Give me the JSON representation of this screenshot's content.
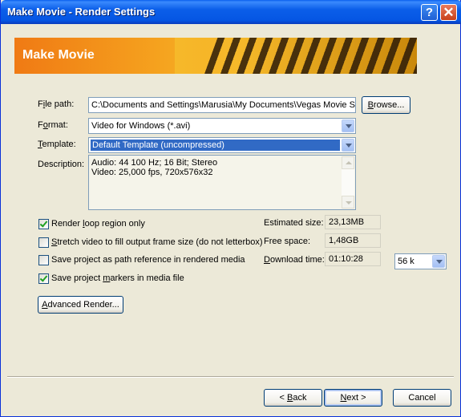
{
  "window": {
    "title": "Make Movie - Render Settings",
    "help_label": "?",
    "close_label": "✕"
  },
  "banner": {
    "title": "Make Movie"
  },
  "file_path": {
    "label_pre": "F",
    "label_ul": "i",
    "label_post": "le path:",
    "value": "C:\\Documents and Settings\\Marusia\\My Documents\\Vegas Movie S",
    "browse_pre": "",
    "browse_ul": "B",
    "browse_post": "rowse..."
  },
  "format": {
    "label_pre": "F",
    "label_ul": "o",
    "label_post": "rmat:",
    "value": "Video for Windows (*.avi)"
  },
  "template": {
    "label_pre": "",
    "label_ul": "T",
    "label_post": "emplate:",
    "value": "Default Template (uncompressed)"
  },
  "description": {
    "label": "Description:",
    "lines": [
      "Audio: 44 100 Hz; 16 Bit; Stereo",
      "Video: 25,000 fps, 720x576x32"
    ]
  },
  "options": [
    {
      "pre": "Render ",
      "ul": "l",
      "post": "oop region only",
      "checked": true
    },
    {
      "pre": "",
      "ul": "S",
      "post": "tretch video to fill output frame size (do not letterbox)",
      "checked": false
    },
    {
      "pre": "Save pro",
      "ul": "j",
      "post": "ect as path reference in rendered media",
      "checked": false
    },
    {
      "pre": "Save project ",
      "ul": "m",
      "post": "arkers in media file",
      "checked": true
    }
  ],
  "stats": {
    "estimated_label": "Estimated size:",
    "estimated_value": "23,13MB",
    "free_label": "Free space:",
    "free_value": "1,48GB",
    "download_label_pre": "",
    "download_label_ul": "D",
    "download_label_post": "ownload time:",
    "download_value": "01:10:28",
    "speed_value": "56 k"
  },
  "buttons": {
    "advanced_pre": "",
    "advanced_ul": "A",
    "advanced_post": "dvanced Render...",
    "back_pre": "< ",
    "back_ul": "B",
    "back_post": "ack",
    "next_pre": "",
    "next_ul": "N",
    "next_post": "ext >",
    "cancel": "Cancel"
  }
}
